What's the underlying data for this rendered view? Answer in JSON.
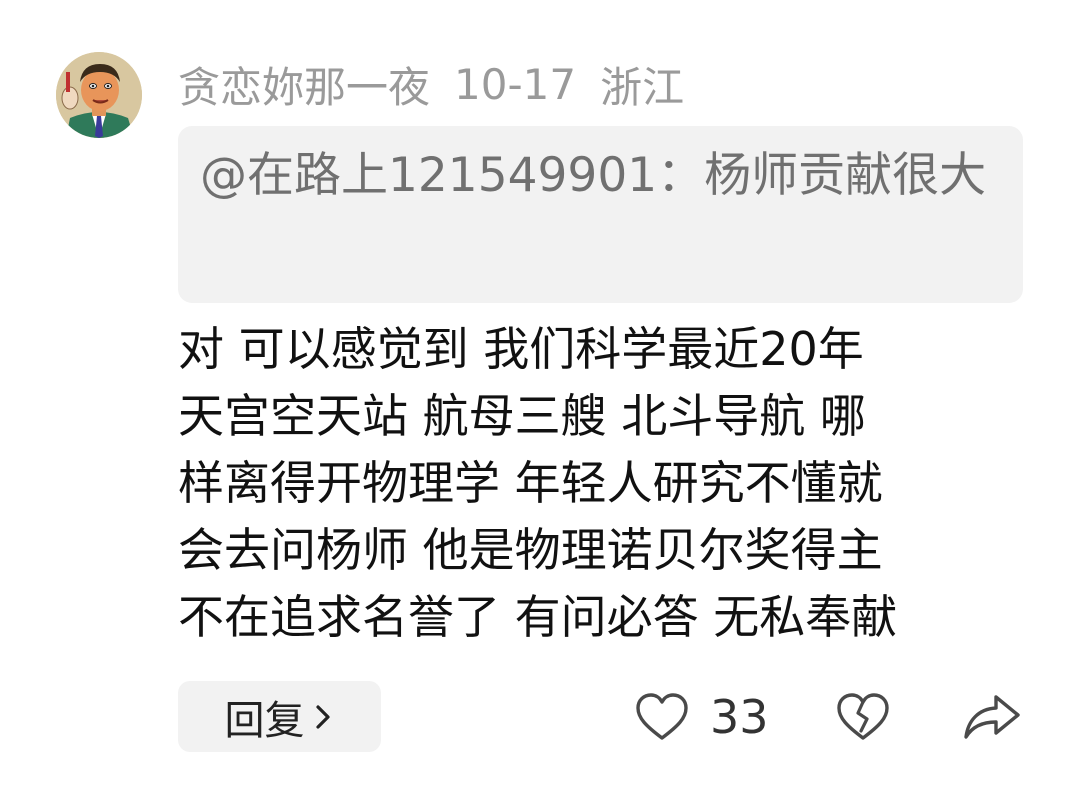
{
  "comment": {
    "username": "贪恋妳那一夜",
    "date": "10-17",
    "location": "浙江",
    "quote": "@在路上121549901：杨师贡献很大",
    "body_lines": [
      "对 可以感觉到 我们科学最近20年",
      "天宫空天站 航母三艘 北斗导航 哪",
      "样离得开物理学 年轻人研究不懂就",
      "会去问杨师 他是物理诺贝尔奖得主",
      "不在追求名誉了 有问必答 无私奉献"
    ]
  },
  "actions": {
    "reply_label": "回复",
    "like_count": "33"
  },
  "icons": {
    "avatar": "cartoon-man-avatar",
    "reply_chevron": "chevron-right-icon",
    "like": "heart-outline-icon",
    "dislike": "broken-heart-icon",
    "share": "share-arrow-icon"
  },
  "colors": {
    "meta_text": "#9a9a9a",
    "quote_background": "#f2f2f2",
    "quote_text": "#707070",
    "body_text": "#111111",
    "icon_stroke": "#4a4a4a"
  }
}
